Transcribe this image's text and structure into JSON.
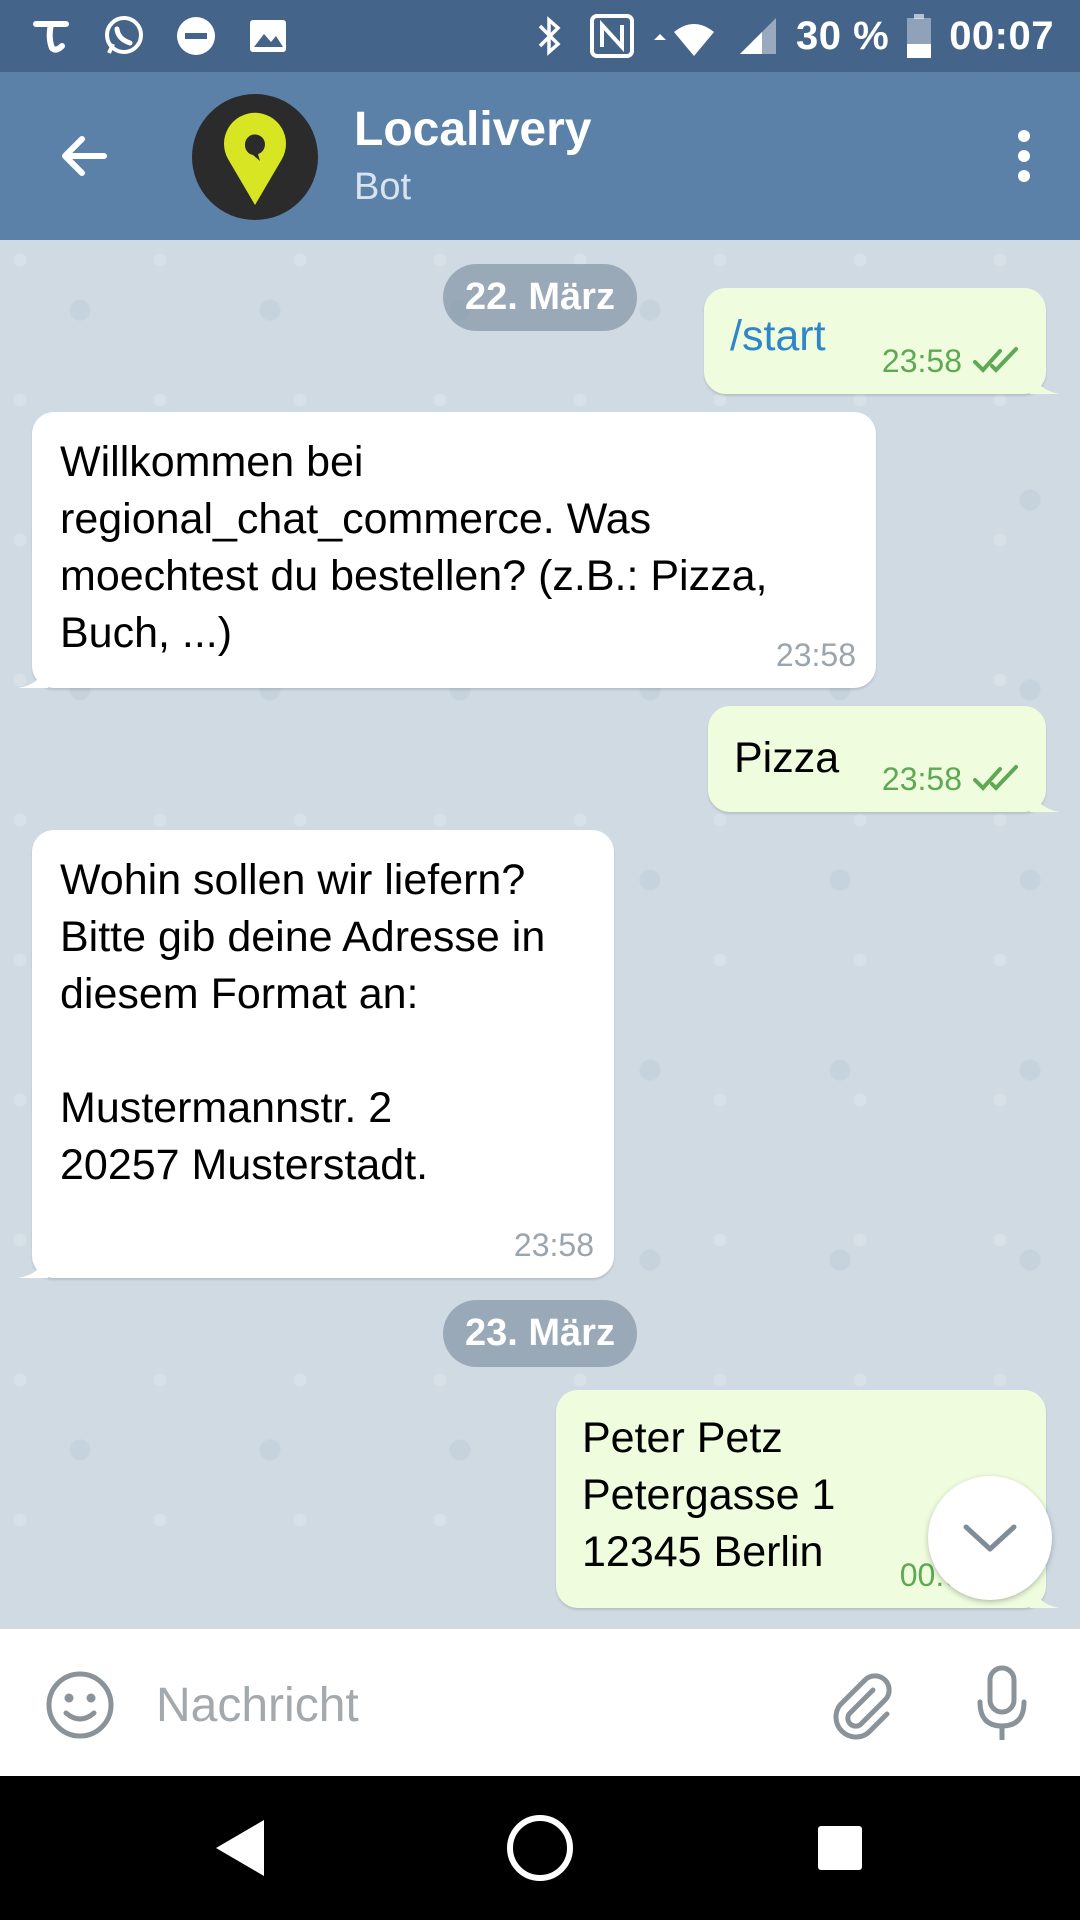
{
  "status_bar": {
    "battery": "30 %",
    "time": "00:07",
    "left_icons": [
      "tuenti-icon",
      "whatsapp-icon",
      "do-not-disturb-icon",
      "gallery-icon"
    ],
    "right_icons": [
      "bluetooth-icon",
      "nfc-icon",
      "wifi-icon",
      "signal-icon",
      "battery-icon"
    ]
  },
  "header": {
    "title": "Localivery",
    "subtitle": "Bot",
    "accent_color": "#5b81a8"
  },
  "messages": [
    {
      "type": "date",
      "text": "22. März"
    },
    {
      "type": "out",
      "text": "/start",
      "time": "23:58",
      "status": "read"
    },
    {
      "type": "in",
      "text": "Willkommen bei regional_chat_commerce. Was moechtest du bestellen? (z.B.: Pizza, Buch, ...)",
      "time": "23:58"
    },
    {
      "type": "out",
      "text": "Pizza",
      "time": "23:58",
      "status": "read"
    },
    {
      "type": "in",
      "text": "Wohin sollen wir liefern? Bitte gib deine Adresse in diesem Format an:\n\nMustermannstr. 2\n20257 Musterstadt.",
      "time": "23:58"
    },
    {
      "type": "date",
      "text": "23. März"
    },
    {
      "type": "out",
      "text": "Peter Petz\nPetergasse 1\n12345 Berlin",
      "time": "00:0",
      "status": "read"
    }
  ],
  "composer": {
    "placeholder": "Nachricht"
  }
}
